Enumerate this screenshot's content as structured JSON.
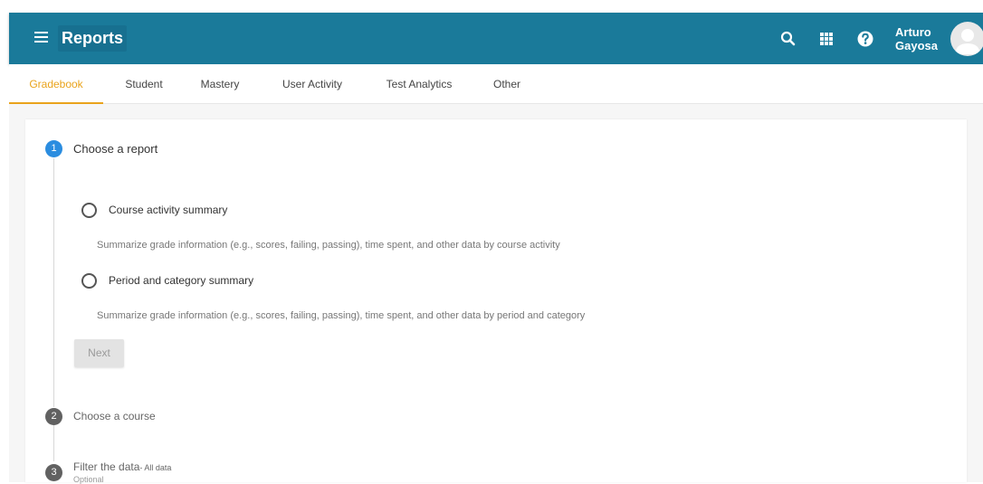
{
  "header": {
    "title": "Reports",
    "user_first": "Arturo",
    "user_last": "Gayosa",
    "icons": [
      "menu-icon",
      "search-icon",
      "apps-grid-icon",
      "help-icon",
      "avatar-icon"
    ],
    "colors": {
      "bar": "#1a7a9a",
      "accent": "#e9a31b",
      "step_active": "#2b8de0"
    }
  },
  "tabs": [
    {
      "label": "Gradebook",
      "active": true
    },
    {
      "label": "Student"
    },
    {
      "label": "Mastery"
    },
    {
      "label": "User Activity"
    },
    {
      "label": "Test Analytics"
    },
    {
      "label": "Other"
    }
  ],
  "steps": [
    {
      "number": "1",
      "title": "Choose a report",
      "options": [
        {
          "label": "Course activity summary",
          "description": "Summarize grade information (e.g., scores, failing, passing), time spent, and other data by course activity"
        },
        {
          "label": "Period and category summary",
          "description": "Summarize grade information (e.g., scores, failing, passing), time spent, and other data by period and category"
        }
      ],
      "next_label": "Next"
    },
    {
      "number": "2",
      "title": "Choose a course"
    },
    {
      "number": "3",
      "title": "Filter the data",
      "suffix": "- All data",
      "subtitle": "Optional"
    }
  ]
}
